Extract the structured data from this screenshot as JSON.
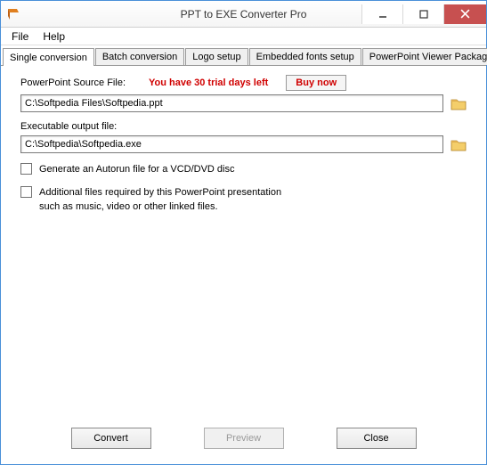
{
  "window": {
    "title": "PPT to EXE Converter Pro"
  },
  "menu": {
    "file": "File",
    "help": "Help"
  },
  "tabs": {
    "single": "Single conversion",
    "batch": "Batch conversion",
    "logo": "Logo setup",
    "fonts": "Embedded fonts setup",
    "viewer": "PowerPoint Viewer Package"
  },
  "panel": {
    "source_label": "PowerPoint Source File:",
    "trial_text": "You have 30 trial days left",
    "buy_now": "Buy now",
    "source_value": "C:\\Softpedia Files\\Softpedia.ppt",
    "output_label": "Executable output file:",
    "output_value": "C:\\Softpedia\\Softpedia.exe",
    "check_autorun": "Generate an Autorun file for a VCD/DVD disc",
    "check_additional_line1": "Additional files required  by this PowerPoint presentation",
    "check_additional_line2": "such as music, video or other linked files."
  },
  "buttons": {
    "convert": "Convert",
    "preview": "Preview",
    "close": "Close"
  }
}
